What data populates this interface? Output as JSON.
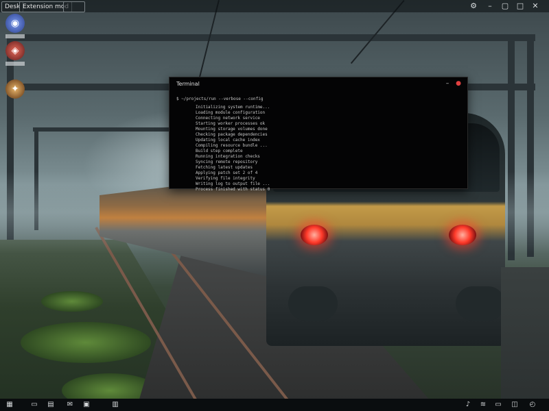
{
  "topbar": {
    "tabs": [
      {
        "label": "Desk"
      },
      {
        "label": "Extension mod"
      },
      {
        "label": ""
      }
    ],
    "tray_icons": [
      "settings-icon",
      "minimize-icon",
      "restore-icon",
      "close-icon"
    ]
  },
  "desktop": {
    "icons": [
      {
        "name": "browser-icon",
        "color": "#4a6ee0"
      },
      {
        "name": "media-icon",
        "color": "#c0392b"
      },
      {
        "name": "star-icon",
        "color": "#b06a20"
      }
    ]
  },
  "terminal": {
    "title": "Terminal",
    "header": "$ ~/projects/run --verbose --config",
    "lines": [
      "Initializing system runtime...",
      "Loading module configuration",
      "Connecting network service",
      "Starting worker processes ok",
      "Mounting storage volumes done",
      "Checking package dependencies",
      "Updating local cache index",
      "Compiling resource bundle ...",
      "Build step complete",
      "Running integration checks",
      "Syncing remote repository",
      "Fetching latest updates",
      "Applying patch set 2 of 4",
      "Verifying file integrity",
      "Writing log to output file ...",
      "Process finished with status 0"
    ]
  },
  "taskbar": {
    "icons": [
      "start-icon",
      "folder-icon",
      "files-icon",
      "mail-icon",
      "terminal-icon",
      "inbox-icon"
    ],
    "tray": [
      "sound-icon",
      "network-icon",
      "battery-icon",
      "notification-icon"
    ]
  }
}
